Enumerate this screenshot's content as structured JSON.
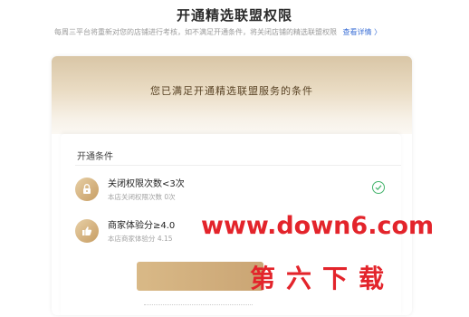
{
  "header": {
    "title": "开通精选联盟权限"
  },
  "notice": {
    "text": "每周三平台将重新对您的店铺进行考核，如不满足开通条件，将关闭店铺的精选联盟权限",
    "link_label": "查看详情 〉"
  },
  "banner": {
    "title": "您已满足开通精选联盟服务的条件"
  },
  "conditions": {
    "label": "开通条件",
    "items": [
      {
        "title": "关闭权限次数<3次",
        "subtitle": "本店关闭权限次数 0次",
        "icon": "lock-icon",
        "status": "met"
      },
      {
        "title": "商家体验分≥4.0",
        "subtitle": "本店商家体验分 4.15",
        "icon": "thumbs-up-icon",
        "status": ""
      }
    ]
  },
  "watermark": {
    "url": "www.down6.com",
    "name": "第六下载"
  },
  "colors": {
    "accent_gold": "#c9a26b",
    "link_blue": "#3b6fd6",
    "check_green": "#43b36b",
    "watermark_red": "#e3242b"
  }
}
